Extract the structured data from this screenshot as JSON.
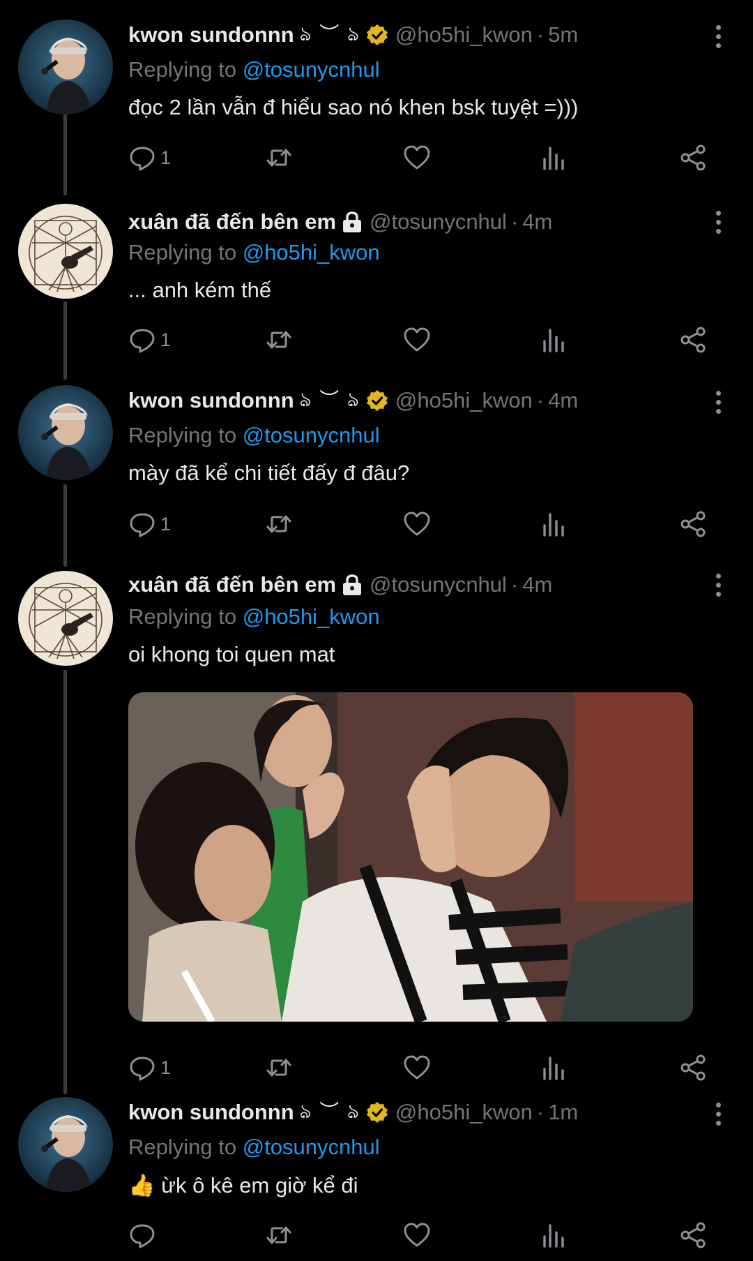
{
  "tweets": [
    {
      "display_name": "kwon sundonnn",
      "name_deco": "ঌ ︶ ঌ",
      "verified": true,
      "handle": "@ho5hi_kwon",
      "time": "5m",
      "replying_prefix": "Replying to",
      "replying_to": "@tosunycnhul",
      "text": "đọc 2 lần vẫn đ hiểu sao nó khen bsk tuyệt =)))",
      "reply_count": "1"
    },
    {
      "display_name": "xuân đã đến bên em",
      "protected": true,
      "handle": "@tosunycnhul",
      "time": "4m",
      "replying_prefix": "Replying to",
      "replying_to": "@ho5hi_kwon",
      "text": "... anh kém thế",
      "reply_count": "1"
    },
    {
      "display_name": "kwon sundonnn",
      "name_deco": "ঌ ︶ ঌ",
      "verified": true,
      "handle": "@ho5hi_kwon",
      "time": "4m",
      "replying_prefix": "Replying to",
      "replying_to": "@tosunycnhul",
      "text": "mày đã kể chi tiết đấy đ đâu?",
      "reply_count": "1"
    },
    {
      "display_name": "xuân đã đến bên em",
      "protected": true,
      "handle": "@tosunycnhul",
      "time": "4m",
      "replying_prefix": "Replying to",
      "replying_to": "@ho5hi_kwon",
      "text": "oi khong toi quen mat",
      "reply_count": "1",
      "has_media": true
    },
    {
      "display_name": "kwon sundonnn",
      "name_deco": "ঌ ︶ ঌ",
      "verified": true,
      "handle": "@ho5hi_kwon",
      "time": "1m",
      "replying_prefix": "Replying to",
      "replying_to": "@tosunycnhul",
      "text": "👍 ừk ô kê em giờ kể đi",
      "reply_count": ""
    }
  ],
  "separator": "·",
  "icons": [
    "reply-icon",
    "retweet-icon",
    "like-icon",
    "analytics-icon",
    "share-icon",
    "more-icon",
    "verified-badge-icon",
    "lock-icon"
  ],
  "colors": {
    "background": "#000000",
    "text": "#e7e9ea",
    "secondary": "#71767b",
    "mention": "#1d9bf0",
    "verified_badge": "#e2b719",
    "thread_line": "#3a3d40"
  }
}
